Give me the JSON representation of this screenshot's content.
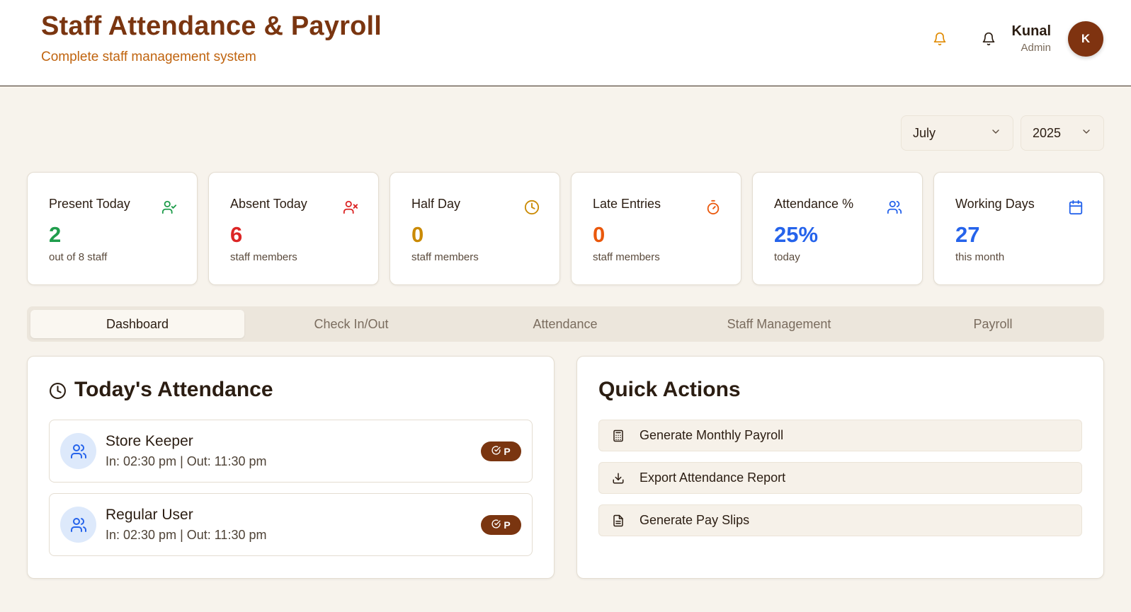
{
  "header": {
    "title": "Staff Attendance & Payroll",
    "subtitle": "Complete staff management system",
    "user": {
      "name": "Kunal",
      "role": "Admin",
      "initial": "K"
    }
  },
  "filters": {
    "month": "July",
    "year": "2025"
  },
  "stats": [
    {
      "label": "Present Today",
      "value": "2",
      "sub": "out of 8 staff",
      "icon": "user-check-icon",
      "color": "#1f9d4c"
    },
    {
      "label": "Absent Today",
      "value": "6",
      "sub": "staff members",
      "icon": "user-x-icon",
      "color": "#dc2626"
    },
    {
      "label": "Half Day",
      "value": "0",
      "sub": "staff members",
      "icon": "clock-icon",
      "color": "#ca8a04"
    },
    {
      "label": "Late Entries",
      "value": "0",
      "sub": "staff members",
      "icon": "timer-icon",
      "color": "#ea580c"
    },
    {
      "label": "Attendance %",
      "value": "25%",
      "sub": "today",
      "icon": "users-icon",
      "color": "#2563eb"
    },
    {
      "label": "Working Days",
      "value": "27",
      "sub": "this month",
      "icon": "calendar-icon",
      "color": "#2563eb"
    }
  ],
  "tabs": [
    {
      "label": "Dashboard",
      "active": true
    },
    {
      "label": "Check In/Out",
      "active": false
    },
    {
      "label": "Attendance",
      "active": false
    },
    {
      "label": "Staff Management",
      "active": false
    },
    {
      "label": "Payroll",
      "active": false
    }
  ],
  "todays_attendance": {
    "title": "Today's Attendance",
    "entries": [
      {
        "name": "Store Keeper",
        "time": "In: 02:30 pm | Out: 11:30 pm",
        "status": "P"
      },
      {
        "name": "Regular User",
        "time": "In: 02:30 pm | Out: 11:30 pm",
        "status": "P"
      }
    ]
  },
  "quick_actions": {
    "title": "Quick Actions",
    "actions": [
      {
        "label": "Generate Monthly Payroll",
        "icon": "calculator-icon"
      },
      {
        "label": "Export Attendance Report",
        "icon": "download-icon"
      },
      {
        "label": "Generate Pay Slips",
        "icon": "file-text-icon"
      }
    ]
  },
  "colors": {
    "brand": "#7a3510",
    "accent": "#c0640f",
    "background": "#f7f3ec"
  }
}
